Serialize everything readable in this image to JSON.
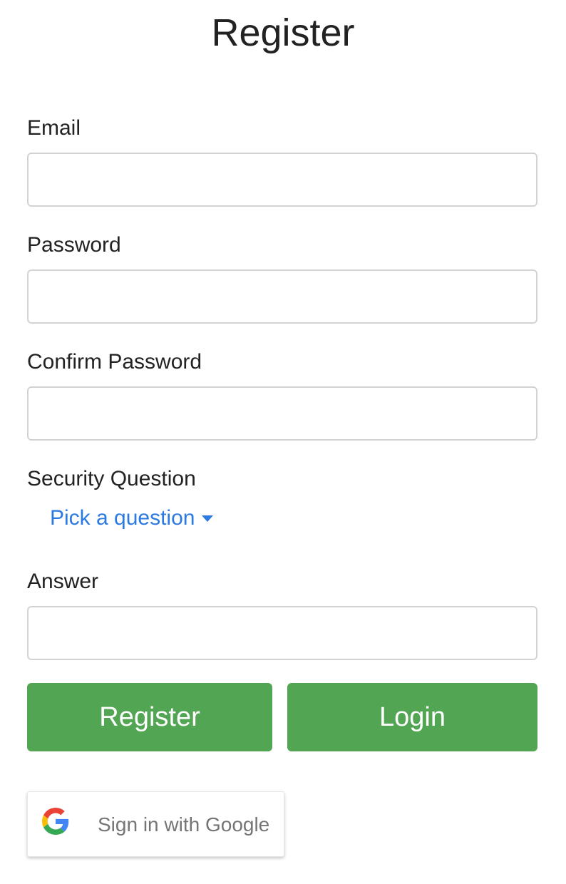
{
  "page": {
    "title": "Register"
  },
  "form": {
    "email": {
      "label": "Email",
      "value": "",
      "placeholder": ""
    },
    "password": {
      "label": "Password",
      "value": "",
      "placeholder": ""
    },
    "confirm_password": {
      "label": "Confirm Password",
      "value": "",
      "placeholder": ""
    },
    "security_question": {
      "label": "Security Question",
      "selected": "Pick a question",
      "icon": "caret-down-icon"
    },
    "answer": {
      "label": "Answer",
      "value": "",
      "placeholder": ""
    }
  },
  "actions": {
    "register_label": "Register",
    "login_label": "Login",
    "google_label": "Sign in with Google",
    "google_icon": "google-g-icon"
  },
  "colors": {
    "primary_button": "#52a553",
    "link": "#2a7ae2",
    "input_border": "#d3d3d3",
    "text": "#222222",
    "google_text": "#757575"
  }
}
